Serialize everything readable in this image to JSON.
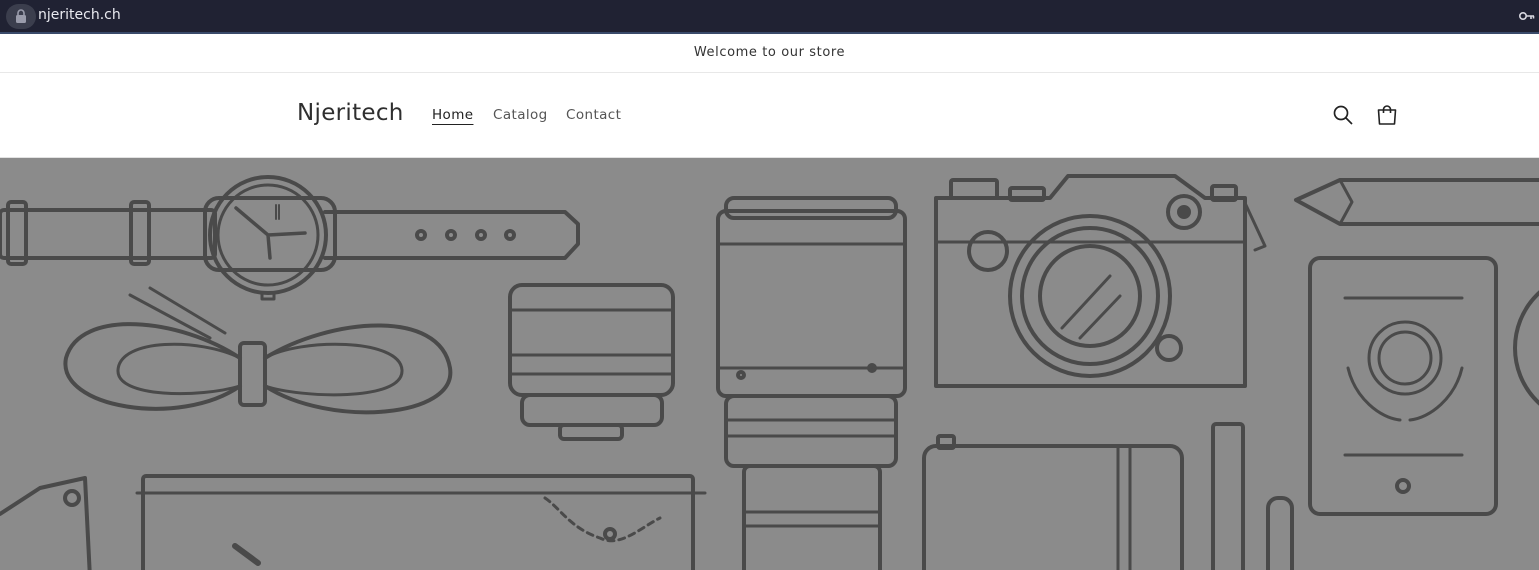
{
  "browser": {
    "url": "njeritech.ch",
    "lock_icon": "lock-icon",
    "key_icon": "key-icon"
  },
  "announcement": {
    "text": "Welcome to our store"
  },
  "header": {
    "logo": "Njeritech",
    "nav": [
      {
        "label": "Home",
        "active": true
      },
      {
        "label": "Catalog",
        "active": false
      },
      {
        "label": "Contact",
        "active": false
      }
    ],
    "search_icon": "search-icon",
    "cart_icon": "cart-icon"
  },
  "hero": {
    "background_color": "#8b8b8b",
    "line_color": "#4a4a4a",
    "illustration": "line-art-gadgets"
  }
}
